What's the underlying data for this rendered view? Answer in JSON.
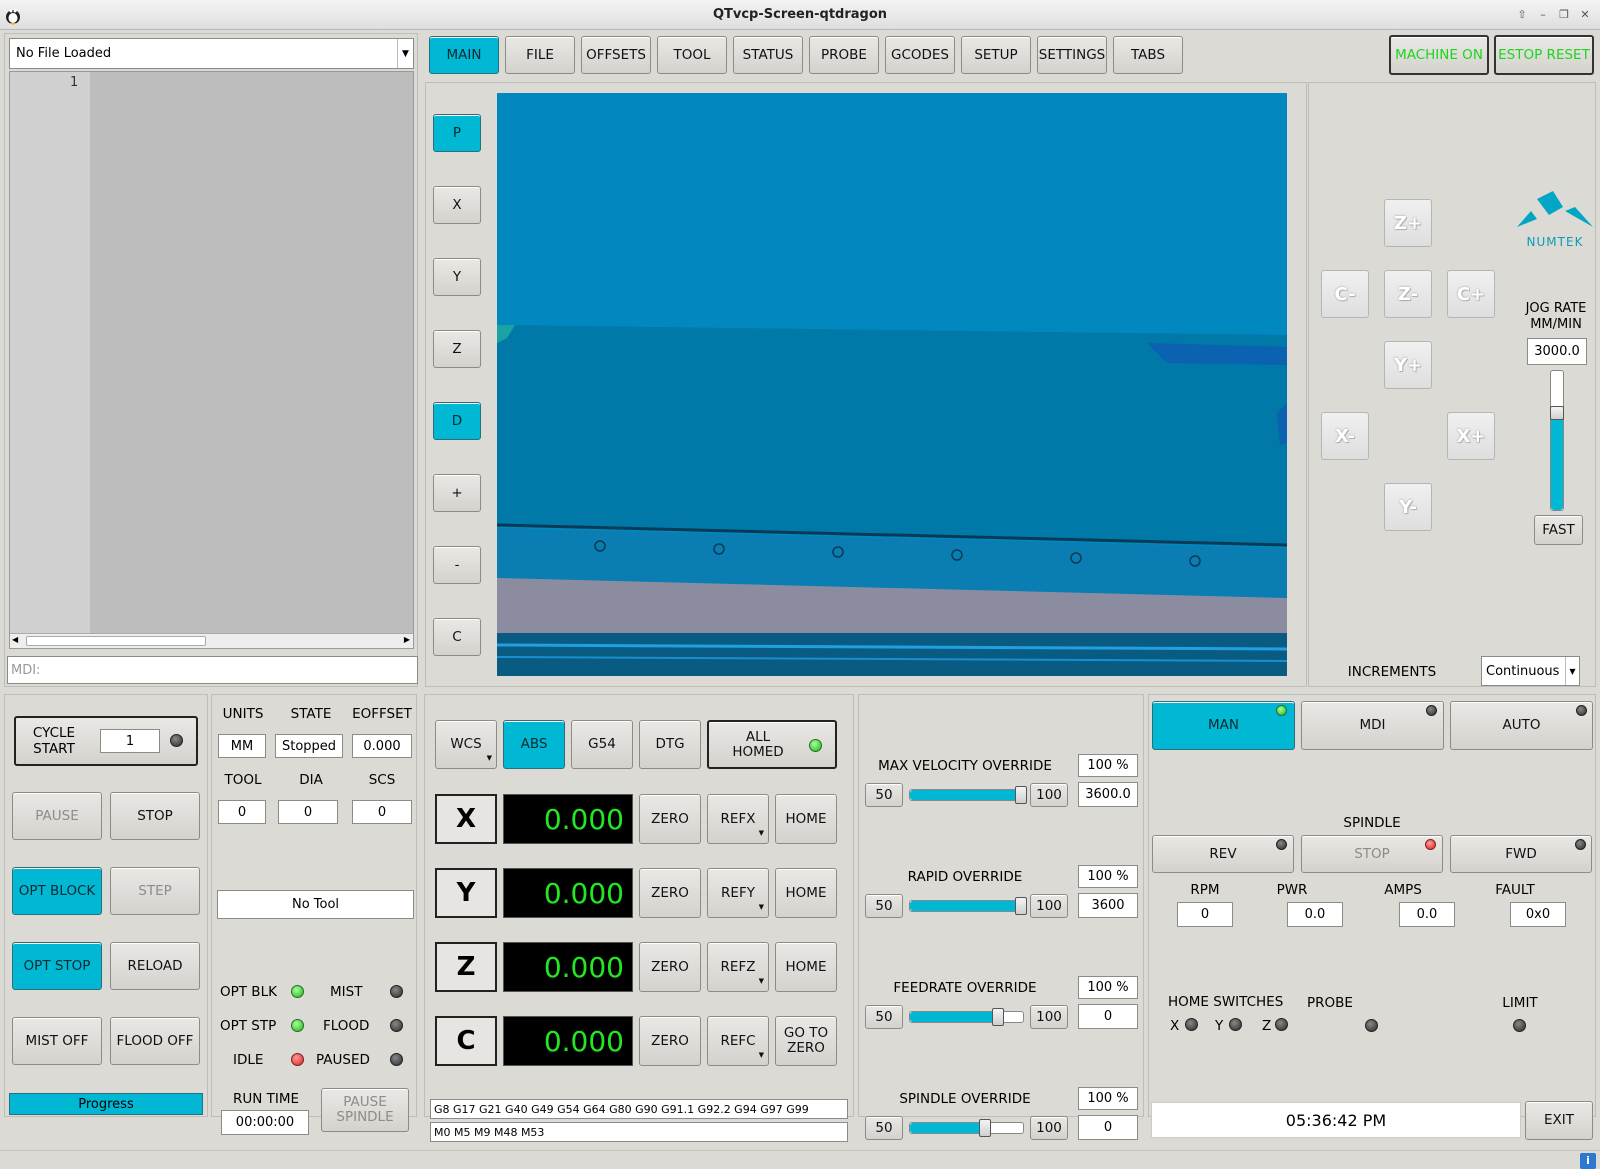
{
  "window": {
    "title": "QTvcp-Screen-qtdragon"
  },
  "file_panel": {
    "file_name": "No File Loaded",
    "line_number": "1",
    "mdi_placeholder": "MDI:"
  },
  "tabs": [
    {
      "label": "MAIN",
      "active": true
    },
    {
      "label": "FILE"
    },
    {
      "label": "OFFSETS"
    },
    {
      "label": "TOOL"
    },
    {
      "label": "STATUS"
    },
    {
      "label": "PROBE"
    },
    {
      "label": "GCODES"
    },
    {
      "label": "SETUP"
    },
    {
      "label": "SETTINGS"
    },
    {
      "label": "TABS"
    }
  ],
  "machine": {
    "machine_on": "MACHINE ON",
    "estop_reset": "ESTOP RESET"
  },
  "view_buttons": [
    "P",
    "X",
    "Y",
    "Z",
    "D",
    "+",
    "-",
    "C"
  ],
  "jog": {
    "buttons": {
      "z_plus": "Z+",
      "c_minus": "C-",
      "z_minus": "Z-",
      "c_plus": "C+",
      "y_plus": "Y+",
      "x_minus": "X-",
      "x_plus": "X+",
      "y_minus": "Y-"
    },
    "logo": "NUMTEK",
    "rate_label": "JOG RATE MM/MIN",
    "rate_value": "3000.0",
    "rate_level": 0.72,
    "fast_label": "FAST",
    "increments_label": "INCREMENTS",
    "increments_value": "Continuous"
  },
  "run_panel": {
    "cycle_start": "CYCLE START",
    "cycle_count": "1",
    "pause": "PAUSE",
    "stop": "STOP",
    "opt_block": "OPT BLOCK",
    "step": "STEP",
    "opt_stop": "OPT STOP",
    "reload": "RELOAD",
    "mist_off": "MIST OFF",
    "flood_off": "FLOOD OFF",
    "progress": "Progress"
  },
  "status": {
    "units_label": "UNITS",
    "units": "MM",
    "state_label": "STATE",
    "state": "Stopped",
    "eoffset_label": "EOFFSET",
    "eoffset": "0.000",
    "tool_label": "TOOL",
    "tool": "0",
    "dia_label": "DIA",
    "dia": "0",
    "scs_label": "SCS",
    "scs": "0",
    "tool_name": "No Tool",
    "opt_blk": "OPT BLK",
    "mist": "MIST",
    "opt_stp": "OPT STP",
    "flood": "FLOOD",
    "idle": "IDLE",
    "paused": "PAUSED",
    "run_time_label": "RUN TIME",
    "run_time": "00:00:00",
    "pause_spindle": "PAUSE SPINDLE"
  },
  "dro": {
    "wcs": "WCS",
    "abs": "ABS",
    "g54": "G54",
    "dtg": "DTG",
    "all_homed": "ALL HOMED",
    "zero": "ZERO",
    "home": "HOME",
    "go_to_zero": "GO TO ZERO",
    "axes": [
      {
        "axis": "X",
        "value": "0.000",
        "ref": "REFX"
      },
      {
        "axis": "Y",
        "value": "0.000",
        "ref": "REFY"
      },
      {
        "axis": "Z",
        "value": "0.000",
        "ref": "REFZ"
      },
      {
        "axis": "C",
        "value": "0.000",
        "ref": "REFC"
      }
    ],
    "gcodes": "G8 G17 G21 G40 G49 G54 G64 G80 G90 G91.1 G92.2 G94 G97 G99",
    "mcodes": "M0 M5 M9 M48 M53"
  },
  "overrides": [
    {
      "label": "MAX VELOCITY OVERRIDE",
      "min": "50",
      "max": "100",
      "percent": "100 %",
      "value": "3600.0",
      "level": 1.0
    },
    {
      "label": "RAPID OVERRIDE",
      "min": "50",
      "max": "100",
      "percent": "100 %",
      "value": "3600",
      "level": 1.0
    },
    {
      "label": "FEEDRATE OVERRIDE",
      "min": "50",
      "max": "100",
      "percent": "100 %",
      "value": "0",
      "level": 0.8
    },
    {
      "label": "SPINDLE OVERRIDE",
      "min": "50",
      "max": "100",
      "percent": "100 %",
      "value": "0",
      "level": 0.68
    }
  ],
  "mode": {
    "man": "MAN",
    "mdi": "MDI",
    "auto": "AUTO"
  },
  "spindle": {
    "title": "SPINDLE",
    "rev": "REV",
    "stop": "STOP",
    "fwd": "FWD",
    "rpm_label": "RPM",
    "rpm": "0",
    "pwr_label": "PWR",
    "pwr": "0.0",
    "amps_label": "AMPS",
    "amps": "0.0",
    "fault_label": "FAULT",
    "fault": "0x0"
  },
  "switches": {
    "home_label": "HOME SWITCHES",
    "x": "X",
    "y": "Y",
    "z": "Z",
    "probe_label": "PROBE",
    "limit_label": "LIMIT"
  },
  "clock": "05:36:42 PM",
  "exit": "EXIT",
  "colors": {
    "accent": "#00b8d4",
    "led_green": "#17b417",
    "led_red": "#e21c1c",
    "dro_text": "#22e822",
    "preview_bg": "#0088bf"
  }
}
